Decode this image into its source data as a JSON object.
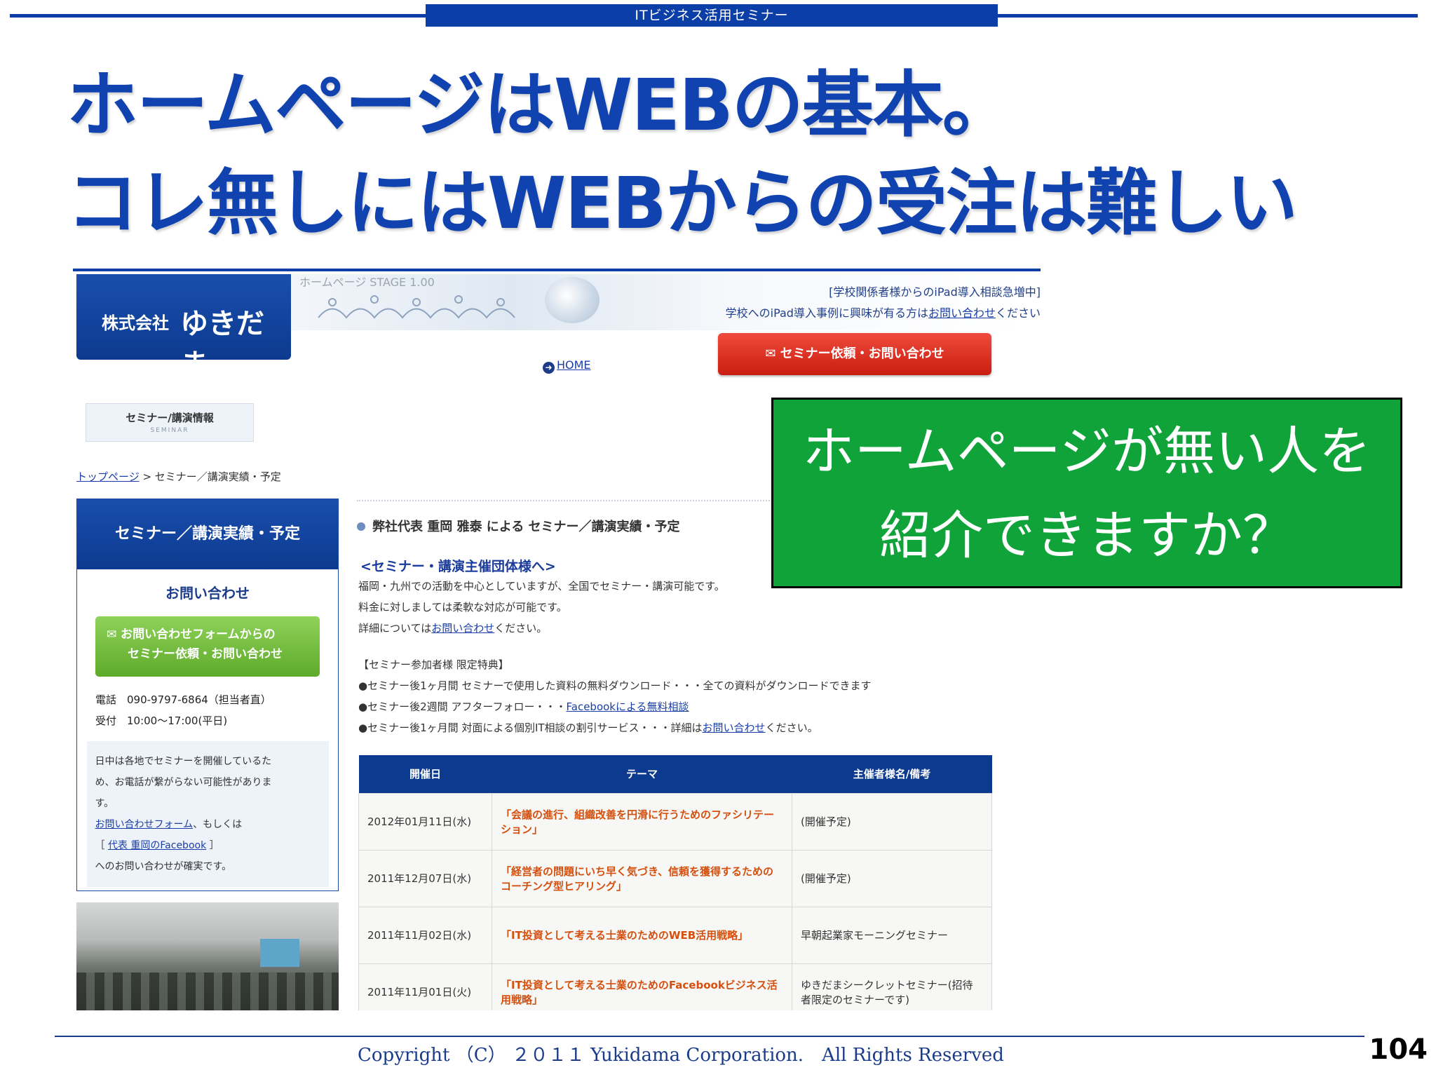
{
  "header": {
    "tab_label": "ITビジネス活用セミナー",
    "headline_1": "ホームページはWEBの基本。",
    "headline_2": "コレ無しにはWEBからの受注は難しい"
  },
  "site": {
    "logo_corp": "株式会社",
    "logo_name": "ゆきだま",
    "stage_label": "ホームページ STAGE 1.00",
    "notice_1": "[学校関係者様からのiPad導入相談急増中]",
    "notice_2_prefix": "学校へのiPad導入事例に興味が有る方は",
    "notice_2_link": "お問い合わせ",
    "notice_2_suffix": "ください",
    "contact_button": "✉ セミナー依頼・お問い合わせ",
    "home_link": "HOME",
    "seminar_tab_title": "セミナー/講演情報",
    "seminar_tab_sub": "SEMINAR",
    "breadcrumb_link": "トップページ",
    "breadcrumb_rest": " > セミナー／講演実績・予定",
    "sidebar": {
      "title": "セミナー／講演実績・予定",
      "contact_heading": "お問い合わせ",
      "form_button_line1": "✉ お問い合わせフォームからの",
      "form_button_line2": "セミナー依頼・お問い合わせ",
      "tel": "電話　090-9797-6864（担当者直）",
      "hours": "受付　10:00〜17:00(平日)",
      "note_1": "日中は各地でセミナーを開催しているた",
      "note_2": "め、お電話が繋がらない可能性がありま",
      "note_3": "す。",
      "note_link_form": "お問い合わせフォーム",
      "note_or": "、もしくは",
      "note_link_fb": "代表 重岡のFacebook",
      "note_end": "へのお問い合わせが確実です。"
    },
    "main": {
      "heading": "弊社代表 重岡 雅泰 による セミナー／講演実績・予定",
      "sub_title": "<セミナー・講演主催団体様へ>",
      "para_1": "福岡・九州での活動を中心としていますが、全国でセミナー・講演可能です。",
      "para_2": "料金に対しましては柔軟な対応が可能です。",
      "para_3_prefix": "詳細については",
      "para_3_link": "お問い合わせ",
      "para_3_suffix": "ください。",
      "bonus_title": "【セミナー参加者様 限定特典】",
      "bonus_1": "●セミナー後1ヶ月間 セミナーで使用した資料の無料ダウンロード・・・全ての資料がダウンロードできます",
      "bonus_2_prefix": "●セミナー後2週間 アフターフォロー・・・",
      "bonus_2_link": "Facebookによる無料相談",
      "bonus_3_prefix": "●セミナー後1ヶ月間 対面による個別IT相談の割引サービス・・・詳細は",
      "bonus_3_link": "お問い合わせ",
      "bonus_3_suffix": "ください。"
    },
    "table": {
      "headers": [
        "開催日",
        "テーマ",
        "主催者様名/備考"
      ],
      "rows": [
        {
          "date": "2012年01月11日(水)",
          "theme": "「会議の進行、組織改善を円滑に行うためのファシリテーション」",
          "note": "(開催予定)"
        },
        {
          "date": "2011年12月07日(水)",
          "theme": "「経営者の問題にいち早く気づき、信頼を獲得するためのコーチング型ヒアリング」",
          "note": "(開催予定)"
        },
        {
          "date": "2011年11月02日(水)",
          "theme": "「IT投資として考える士業のためのWEB活用戦略」",
          "note": "早朝起業家モーニングセミナー"
        },
        {
          "date": "2011年11月01日(火)",
          "theme": "「IT投資として考える士業のためのFacebookビジネス活用戦略」",
          "note": "ゆきだまシークレットセミナー(招待者限定のセミナーです)"
        }
      ]
    }
  },
  "callout": {
    "line_1": "ホームページが無い人を",
    "line_2": "紹介できますか？"
  },
  "footer": {
    "copyright": "Copyright （C） ２０１１ Yukidama Corporation.　All Rights Reserved",
    "page_number": "104"
  },
  "colors": {
    "brand_blue": "#0b3ea6",
    "callout_green": "#10a33a",
    "red_button": "#dc3526",
    "green_button": "#6fbb38"
  }
}
